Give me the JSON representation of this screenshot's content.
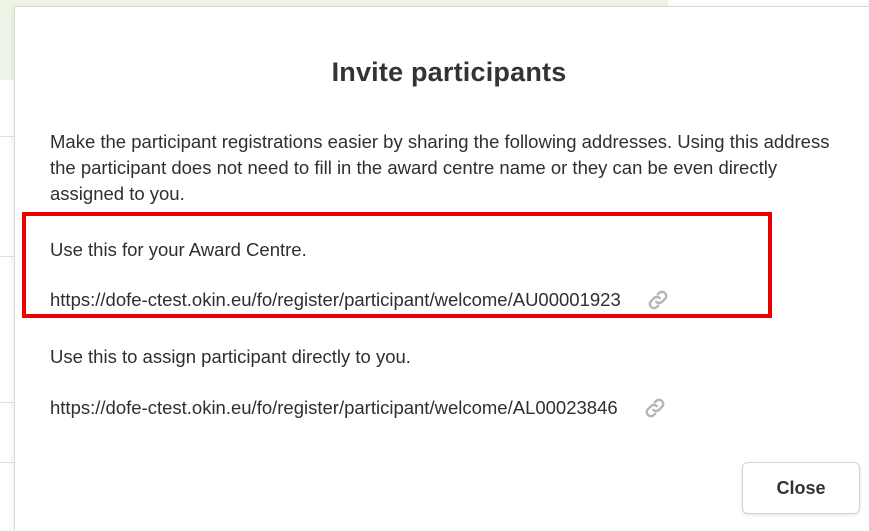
{
  "modal": {
    "title": "Invite participants",
    "intro": "Make the participant registrations easier by sharing the following addresses. Using this address the participant does not need to fill in the award centre name or they can be even directly assigned to you.",
    "award_centre": {
      "label": "Use this for your Award Centre.",
      "url": "https://dofe-ctest.okin.eu/fo/register/participant/welcome/AU00001923",
      "icon": "link-icon"
    },
    "direct": {
      "label": "Use this to assign participant directly to you.",
      "url": "https://dofe-ctest.okin.eu/fo/register/participant/welcome/AL00023846",
      "icon": "link-icon"
    },
    "close_label": "Close"
  },
  "colors": {
    "highlight": "#ee0000",
    "background_band": "#eef5e6",
    "text": "#2f2f2f",
    "icon": "#b5b5b5"
  }
}
